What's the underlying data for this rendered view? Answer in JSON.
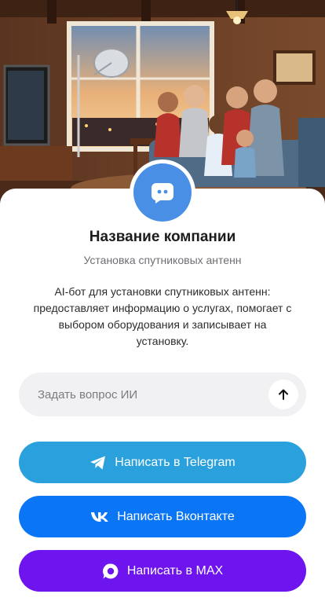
{
  "company": {
    "name": "Название компании",
    "subtitle": "Установка спутниковых антенн",
    "description": "AI-бот для установки спутниковых антенн: предоставляет информацию о услугах, помогает с выбором оборудования и записывает на установку."
  },
  "ask": {
    "placeholder": "Задать вопрос ИИ"
  },
  "buttons": {
    "telegram": "Написать в Telegram",
    "vk": "Написать Вконтакте",
    "max": "Написать в MAX"
  },
  "icons": {
    "avatar": "chat-bubble-icon",
    "send": "arrow-up-icon",
    "telegram": "telegram-icon",
    "vk": "vk-icon",
    "max": "max-icon"
  },
  "colors": {
    "avatar": "#4a8fe6",
    "telegram": "#2aa1dd",
    "vk": "#0a76f5",
    "max": "#6e14ee"
  }
}
